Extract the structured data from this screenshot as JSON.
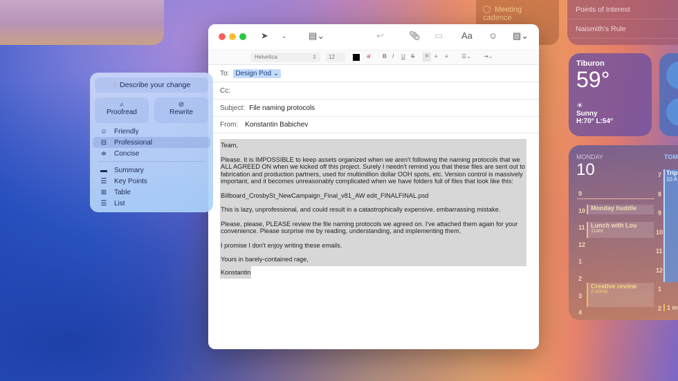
{
  "widgets": {
    "reminders": {
      "item": "Meeting cadence"
    },
    "maps": {
      "items": [
        "Points of Interest",
        "Naismith's Rule"
      ]
    },
    "weather": {
      "city": "Tiburon",
      "temp": "59°",
      "condition": "Sunny",
      "hilo": "H:70° L:54°"
    },
    "calendar": {
      "day": "MONDAY",
      "date": "10",
      "next_day": "TOM",
      "hours": [
        "9",
        "10",
        "11",
        "12",
        "1",
        "2",
        "3",
        "4"
      ],
      "next_hours": [
        "7",
        "8",
        "9",
        "10",
        "11",
        "12",
        "1",
        "2"
      ],
      "events": [
        {
          "title": "Monday huddle",
          "time": ""
        },
        {
          "title": "Lunch with Lou",
          "time": "11AM"
        },
        {
          "title": "Creative review",
          "time": "2:30PM"
        }
      ],
      "next_events": [
        {
          "title": "Trip",
          "time": "10 A"
        },
        {
          "title": "1 m",
          "time": ""
        }
      ]
    }
  },
  "mail": {
    "format": {
      "font": "Helvetica",
      "size": "12"
    },
    "to_label": "To:",
    "to_value": "Design Pod",
    "cc_label": "Cc:",
    "subject_label": "Subject:",
    "subject": "File naming protocols",
    "from_label": "From:",
    "from": "Konstantin Babichev",
    "body": [
      "Team,",
      "Please. It is IMPOSSIBLE to keep assets organized when we aren't following the naming protocols that we ALL AGREED ON when we kicked off this project. Surely I needn't remind you that these files are sent out to fabrication and production partners, used for multimillion dollar OOH spots, etc. Version control is massively important, and it becomes unreasonably complicated when we have folders full of files that look like this:",
      "Billboard_CrosbySt_NewCampaign_Final_v81_AW edit_FINALFINAL.psd",
      "This is lazy, unprofessional, and could result in a catastrophically expensive, embarrassing mistake.",
      "Please, please, PLEASE review the file naming protocols we agreed on. I've attached them again for your convenience. Please surprise me by reading, understanding, and implementing them.",
      "I promise I don't enjoy writing these emails.",
      "Yours in barely-contained rage,",
      "Konstantin"
    ]
  },
  "writing_tools": {
    "describe": "Describe your change",
    "proofread": "Proofread",
    "rewrite": "Rewrite",
    "tones": [
      "Friendly",
      "Professional",
      "Concise"
    ],
    "selected": "Professional",
    "formats": [
      "Summary",
      "Key Points",
      "Table",
      "List"
    ]
  },
  "colors": {
    "close": "#fe5f57",
    "minimize": "#febc2e",
    "zoom": "#28c840",
    "selection": "#d7d7d7"
  }
}
